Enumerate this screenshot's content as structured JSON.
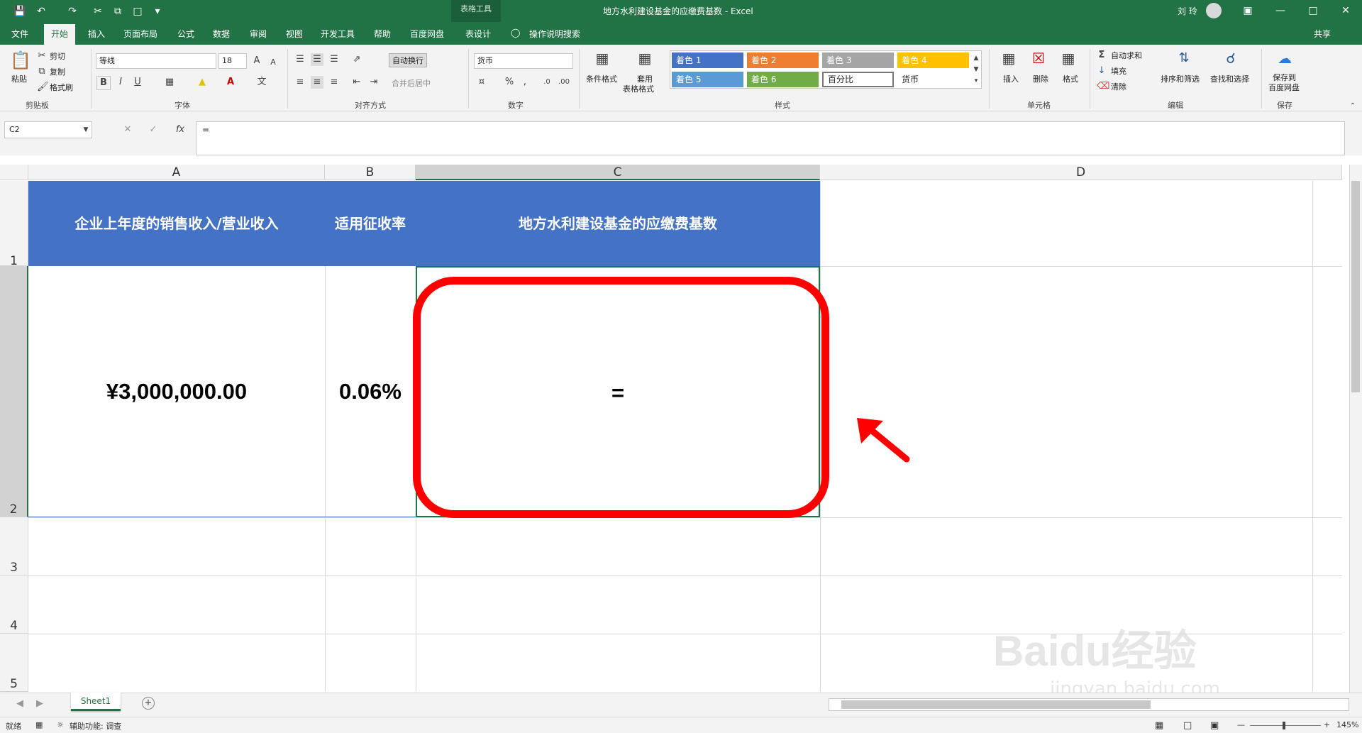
{
  "title_bar": {
    "context_tools": "表格工具",
    "doc_title": "地方水利建设基金的应缴费基数  -  Excel",
    "user": "刘 玲"
  },
  "tabs": [
    "文件",
    "开始",
    "插入",
    "页面布局",
    "公式",
    "数据",
    "审阅",
    "视图",
    "开发工具",
    "帮助",
    "百度网盘",
    "表设计"
  ],
  "tell_me": "操作说明搜索",
  "share": "共享",
  "ribbon": {
    "clipboard": {
      "paste": "粘贴",
      "cut": "剪切",
      "copy": "复制",
      "format_painter": "格式刷",
      "label": "剪贴板"
    },
    "font": {
      "name": "等线",
      "size": "18",
      "label": "字体"
    },
    "alignment": {
      "wrap": "自动换行",
      "merge": "合并后居中",
      "label": "对齐方式"
    },
    "number": {
      "format": "货币",
      "label": "数字"
    },
    "styles": {
      "conditional": "条件格式",
      "table_format_1": "套用",
      "table_format_2": "表格格式",
      "cells": [
        {
          "text": "着色 1",
          "color": "#4472c4"
        },
        {
          "text": "着色 2",
          "color": "#ed7d31"
        },
        {
          "text": "着色 3",
          "color": "#a5a5a5"
        },
        {
          "text": "着色 4",
          "color": "#ffc000"
        },
        {
          "text": "着色 5",
          "color": "#5b9bd5"
        },
        {
          "text": "着色 6",
          "color": "#70ad47"
        },
        {
          "text": "百分比",
          "color": "#ffffff"
        },
        {
          "text": "货币",
          "color": "#ffffff"
        }
      ],
      "label": "样式"
    },
    "cells": {
      "insert": "插入",
      "delete": "删除",
      "format": "格式",
      "label": "单元格"
    },
    "editing": {
      "autosum": "自动求和",
      "fill": "填充",
      "clear": "清除",
      "sort": "排序和筛选",
      "find": "查找和选择",
      "label": "编辑"
    },
    "save": {
      "line1": "保存到",
      "line2": "百度网盘",
      "label": "保存"
    }
  },
  "formula_bar": {
    "name_box": "C2",
    "formula": "="
  },
  "columns": [
    "A",
    "B",
    "C",
    "D"
  ],
  "rows": [
    "1",
    "2",
    "3",
    "4",
    "5"
  ],
  "cells": {
    "A1": "企业上年度的销售收入/营业收入",
    "B1": "适用征收率",
    "C1": "地方水利建设基金的应缴费基数",
    "A2": "¥3,000,000.00",
    "B2": "0.06%",
    "C2": "="
  },
  "sheet_tabs": [
    "Sheet1"
  ],
  "status": {
    "ready": "就绪",
    "accessibility": "辅助功能: 调查",
    "zoom": "145%"
  },
  "watermark": {
    "line1": "Baidu经验",
    "line2": "jingyan.baidu.com"
  }
}
